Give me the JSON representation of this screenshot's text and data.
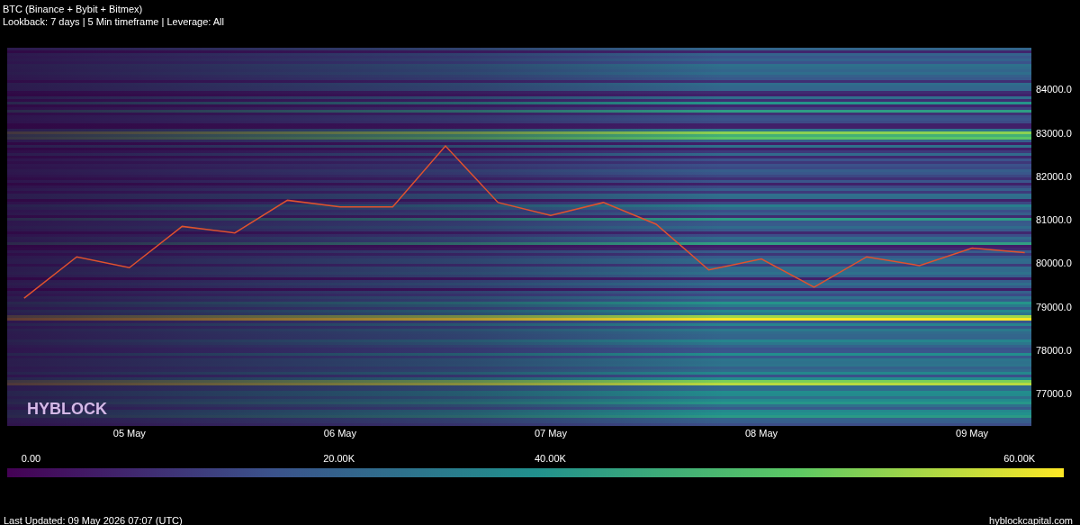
{
  "title": "BTC (Binance + Bybit + Bitmex)",
  "subtitle": "Lookback: 7 days | 5 Min timeframe | Leverage: All",
  "watermark_logo": "HYBLOCK",
  "chart_data": {
    "type": "line",
    "categories": [
      null,
      null,
      "05 May",
      null,
      null,
      null,
      "06 May",
      null,
      null,
      null,
      "07 May",
      null,
      null,
      null,
      "08 May",
      null,
      null,
      null,
      "09 May",
      null
    ],
    "series": [
      {
        "color": "#e0522e",
        "values": [
          79200,
          80150,
          79900,
          80850,
          80700,
          81450,
          81300,
          81300,
          82700,
          81400,
          81100,
          81400,
          80900,
          79850,
          80100,
          79450,
          80150,
          79950,
          80350,
          80250
        ]
      }
    ],
    "ylim": [
      76260,
      84960
    ],
    "yticks": [
      {
        "value": 84000,
        "label": "84000.0"
      },
      {
        "value": 83000,
        "label": "83000.0"
      },
      {
        "value": 82000,
        "label": "82000.0"
      },
      {
        "value": 81000,
        "label": "81000.0"
      },
      {
        "value": 80000,
        "label": "80000.0"
      },
      {
        "value": 79000,
        "label": "79000.0"
      },
      {
        "value": 78000,
        "label": "78000.0"
      },
      {
        "value": 77000,
        "label": "77000.0"
      }
    ]
  },
  "colorbar_labels": [
    "0.00",
    "20.00K",
    "40.00K",
    "60.00K"
  ],
  "last_updated": "Last Updated: 09 May 2026 07:07 (UTC)",
  "source": "hyblockcapital.com"
}
